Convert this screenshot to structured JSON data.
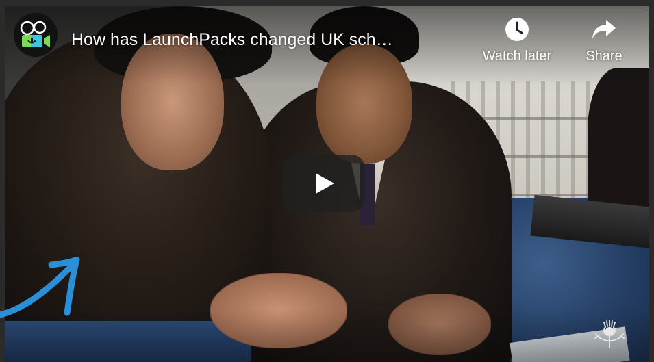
{
  "video": {
    "title": "How has LaunchPacks changed UK sch…",
    "actions": [
      {
        "label": "Watch later",
        "icon": "clock-icon"
      },
      {
        "label": "Share",
        "icon": "share-arrow-icon"
      }
    ],
    "play_icon": "play-icon"
  },
  "colors": {
    "play_bg": "#212121",
    "annotation_arrow": "#2a8fd6",
    "avatar_accent_green": "#7ed957",
    "avatar_accent_teal": "#3ec6d8"
  }
}
